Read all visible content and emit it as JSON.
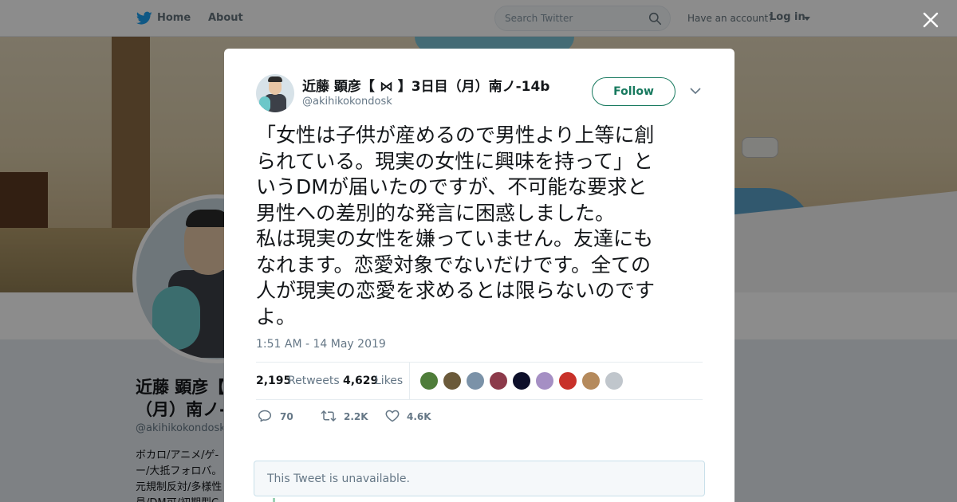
{
  "nav": {
    "home": "Home",
    "about": "About",
    "search_placeholder": "Search Twitter",
    "have_account": "Have an account?",
    "login": "Log in"
  },
  "profile": {
    "name_line1": "近藤 顕彦【",
    "name_line2": "（月）南ノ-",
    "handle": "@akihikokondosk",
    "bio_lines": [
      "ボカロ/アニメ/ゲ-",
      "ー/大抵フォロバ。",
      "元規制反対/多様性",
      "員/DM可/初期型C"
    ]
  },
  "tweet": {
    "author_name": "近藤 顕彦【 ⋈ 】3日目（月）南ノ-14b",
    "author_handle": "@akihikokondosk",
    "follow_label": "Follow",
    "text_lines": [
      "「女性は子供が産めるので男性より上等に創",
      "られている。現実の女性に興味を持って」と",
      "いうDMが届いたのですが、不可能な要求と",
      "男性への差別的な発言に困惑しました。",
      "私は現実の女性を嫌っていません。友達にも",
      "なれます。恋愛対象でないだけです。全ての",
      "人が現実の恋愛を求めるとは限らないのです",
      "よ。"
    ],
    "timestamp": "1:51 AM - 14 May 2019",
    "retweets_count": "2,195",
    "retweets_label": "Retweets",
    "likes_count": "4,629",
    "likes_label": "Likes",
    "liker_colors": [
      "#4f7d3a",
      "#6b5a3a",
      "#7b92a8",
      "#8c3a4a",
      "#0d0f2a",
      "#a58fc4",
      "#c8312a",
      "#b58a5c",
      "#c0c6cc"
    ],
    "actions": {
      "reply": "70",
      "retweet": "2.2K",
      "like": "4.6K"
    },
    "unavailable": "This Tweet is unavailable."
  },
  "colors": {
    "brand_blue": "#1da1f2",
    "follow_green": "#17795e"
  }
}
